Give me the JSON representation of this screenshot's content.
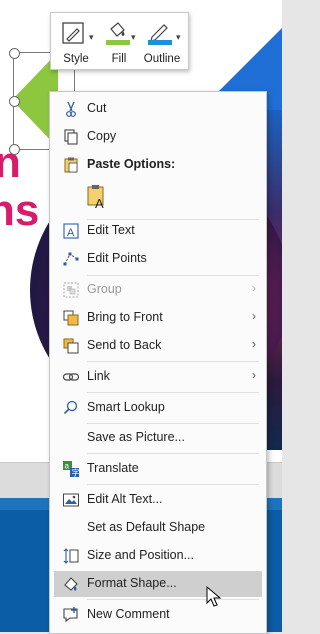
{
  "mini_toolbar": {
    "style_label": "Style",
    "fill_label": "Fill",
    "outline_label": "Outline",
    "fill_color": "#8dc63f",
    "outline_color": "#1e90d8"
  },
  "slide": {
    "pink_text_1": "n",
    "pink_text_2": "ns",
    "accent_pink": "#d81b6b",
    "accent_green": "#8dc63f",
    "accent_blue": "#0b5da5"
  },
  "context_menu": {
    "cut": "Cut",
    "copy": "Copy",
    "paste_options": "Paste Options:",
    "edit_text": "Edit Text",
    "edit_points": "Edit Points",
    "group": "Group",
    "bring_to_front": "Bring to Front",
    "send_to_back": "Send to Back",
    "link": "Link",
    "smart_lookup": "Smart Lookup",
    "save_as_picture": "Save as Picture...",
    "translate": "Translate",
    "edit_alt_text": "Edit Alt Text...",
    "set_default_shape": "Set as Default Shape",
    "size_and_position": "Size and Position...",
    "format_shape": "Format Shape...",
    "new_comment": "New Comment"
  }
}
